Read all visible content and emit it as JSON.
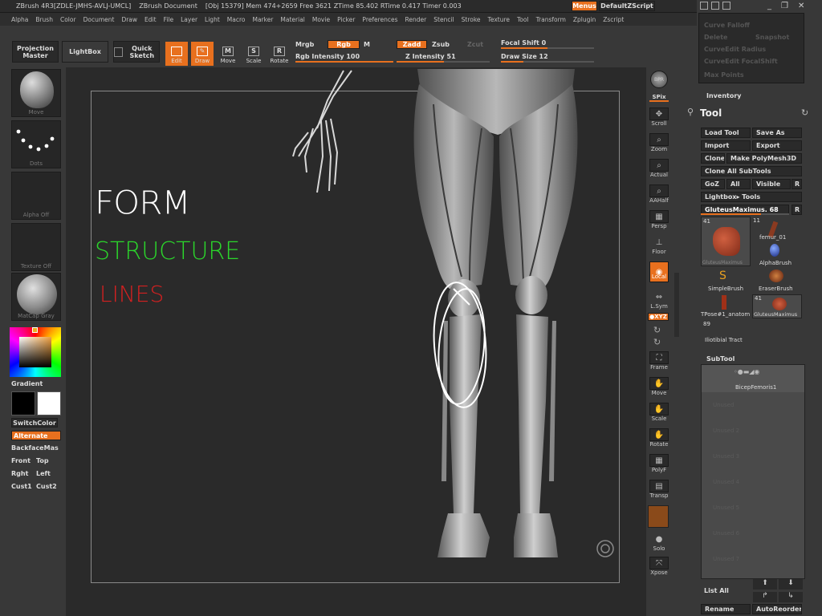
{
  "titlebar": {
    "app": "ZBrush 4R3[ZDLE-JMHS-AVLJ-UMCL]",
    "document": "ZBrush Document",
    "stats": "[Obj 15379] Mem 474+2659 Free 3621 ZTime 85.402 RTime 0.417 Timer 0.003",
    "menus_label": "Menus",
    "script_label": "DefaultZScript"
  },
  "menubar": [
    "Alpha",
    "Brush",
    "Color",
    "Document",
    "Draw",
    "Edit",
    "File",
    "Layer",
    "Light",
    "Macro",
    "Marker",
    "Material",
    "Movie",
    "Picker",
    "Preferences",
    "Render",
    "Stencil",
    "Stroke",
    "Texture",
    "Tool",
    "Transform",
    "Zplugin",
    "Zscript"
  ],
  "toolbar": {
    "projection_master": "Projection Master",
    "lightbox": "LightBox",
    "quick_sketch": "Quick Sketch",
    "edit": "Edit",
    "draw": "Draw",
    "move": "Move",
    "scale": "Scale",
    "rotate": "Rotate",
    "move_ic": "M",
    "scale_ic": "S",
    "rotate_ic": "R",
    "mrgb": "Mrgb",
    "rgb": "Rgb",
    "m": "M",
    "rgb_intensity": "Rgb Intensity 100",
    "zadd": "Zadd",
    "zsub": "Zsub",
    "zcut": "Zcut",
    "z_intensity": "Z Intensity 51",
    "focal_shift": "Focal Shift 0",
    "draw_size": "Draw Size 12"
  },
  "leftpanel": {
    "move_label": "Move",
    "dots_label": "Dots",
    "alpha_label": "Alpha Off",
    "texture_label": "Texture Off",
    "matcap_label": "MatCap Gray",
    "gradient": "Gradient",
    "switchcolor": "SwitchColor",
    "alternate": "Alternate",
    "backface": "BackfaceMas",
    "front": "Front",
    "top": "Top",
    "right": "Rght",
    "left": "Left",
    "cust1": "Cust1",
    "cust2": "Cust2"
  },
  "canvas_text": {
    "form": "FORM",
    "structure": "STRUCTURE",
    "lines": "LINES",
    "form_color": "#ffffff",
    "structure_color": "#2bd62b",
    "lines_color": "#d42020"
  },
  "shelf": {
    "bpr": "BPR",
    "spix": "SPix",
    "scroll": "Scroll",
    "zoom": "Zoom",
    "actual": "Actual",
    "aahalf": "AAHalf",
    "persp": "Persp",
    "floor": "Floor",
    "local": "Local",
    "lsym": "L.Sym",
    "xyz": "●XYZ",
    "frame": "Frame",
    "move": "Move",
    "scale": "Scale",
    "rotate": "Rotate",
    "polyf": "PolyF",
    "transp": "Transp",
    "solo": "Solo",
    "xpose": "Xpose"
  },
  "tray": {
    "curve_falloff": "Curve Falloff",
    "delete": "Delete",
    "snapshot": "Snapshot",
    "curve_edit_radius": "CurveEdit Radius",
    "curve_edit_focal": "CurveEdit FocalShift",
    "max_points": "Max Points",
    "inventory": "Inventory",
    "tool_title": "Tool",
    "load_tool": "Load Tool",
    "save_as": "Save As",
    "import": "Import",
    "export": "Export",
    "clone": "Clone",
    "make_polymesh": "Make PolyMesh3D",
    "clone_all": "Clone All SubTools",
    "goz": "GoZ",
    "all": "All",
    "visible": "Visible",
    "r": "R",
    "lightbox_tools": "Lightbox▸ Tools",
    "current_tool": "GluteusMaximus. 68",
    "t_count1": "41",
    "t_count2": "11",
    "t_count3": "41",
    "t_count4": "89",
    "t_gluteus": "GluteusMaximus",
    "t_femur": "femur_01",
    "t_alphabrush": "AlphaBrush",
    "t_simplebrush": "SimpleBrush",
    "t_eraserbrush": "EraserBrush",
    "t_tpose": "TPose#1_anatom",
    "t_gluteus2": "GluteusMaximus",
    "t_iliotibial": "Iliotibial Tract",
    "subtool_title": "SubTool",
    "subtool_item": "BicepFemoris1",
    "list_all": "List All",
    "rename": "Rename",
    "autoreorder": "AutoReorder",
    "unused": [
      "Unused",
      "Unused 2",
      "Unused 3",
      "Unused 4",
      "Unused 5",
      "Unused 6",
      "Unused 7"
    ]
  },
  "sliders": {
    "rgb_intensity": 1.0,
    "z_intensity": 0.51,
    "focal_shift": 0.5,
    "draw_size": 0.1,
    "current_tool": 0.68
  },
  "colors": {
    "accent": "#e8701e",
    "background": "#2a2a2a",
    "panel": "#383838"
  }
}
